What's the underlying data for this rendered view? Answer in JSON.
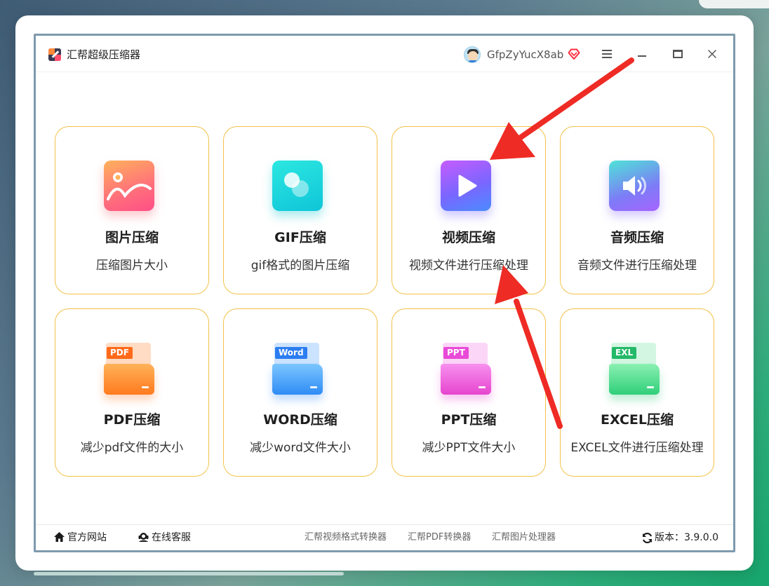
{
  "window": {
    "title": "汇帮超级压缩器",
    "username": "GfpZyYucX8ab"
  },
  "cards": [
    {
      "name": "图片压缩",
      "desc": "压缩图片大小"
    },
    {
      "name": "GIF压缩",
      "desc": "gif格式的图片压缩"
    },
    {
      "name": "视频压缩",
      "desc": "视频文件进行压缩处理"
    },
    {
      "name": "音频压缩",
      "desc": "音频文件进行压缩处理"
    },
    {
      "name": "PDF压缩",
      "desc": "减少pdf文件的大小",
      "badge": "PDF"
    },
    {
      "name": "WORD压缩",
      "desc": "减少word文件大小",
      "badge": "Word"
    },
    {
      "name": "PPT压缩",
      "desc": "减少PPT文件大小",
      "badge": "PPT"
    },
    {
      "name": "EXCEL压缩",
      "desc": "EXCEL文件进行压缩处理",
      "badge": "EXL"
    }
  ],
  "footer": {
    "website": "官方网站",
    "support": "在线客服",
    "links": [
      "汇帮视频格式转换器",
      "汇帮PDF转换器",
      "汇帮图片处理器"
    ],
    "version": "版本：3.9.0.0"
  },
  "colors": {
    "card_border": "#f2c24a",
    "annotation_arrow": "#ee2b24"
  }
}
